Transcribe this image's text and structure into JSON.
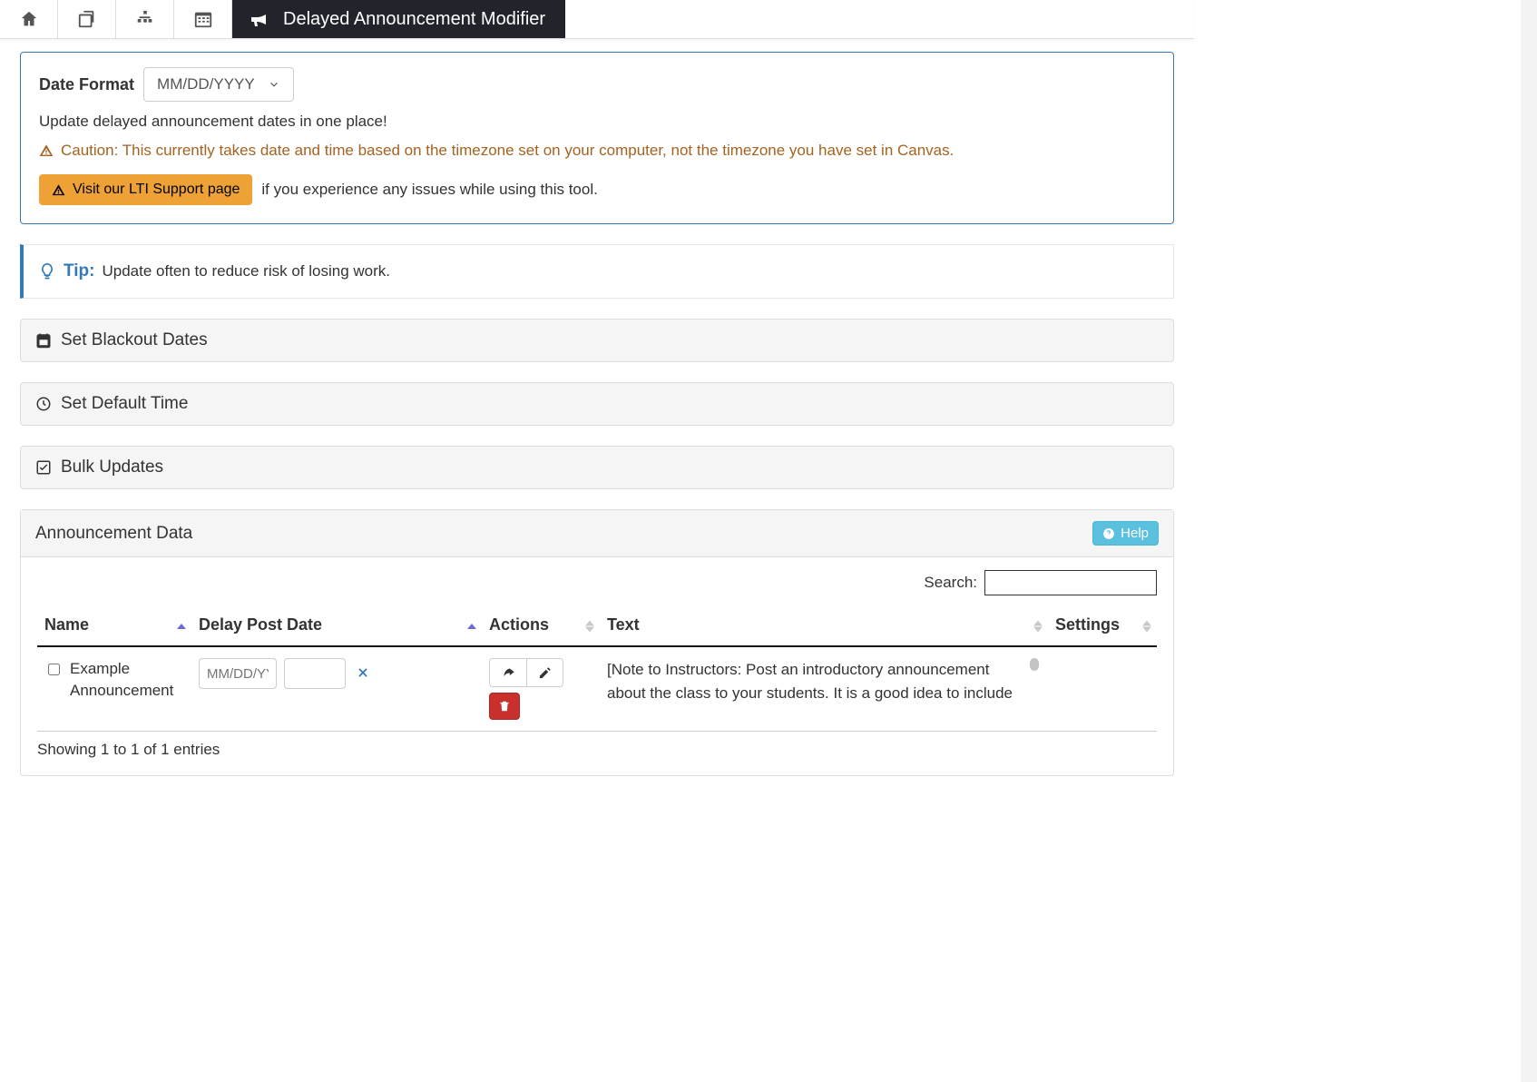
{
  "nav": {
    "active_label": "Delayed Announcement Modifier"
  },
  "panel": {
    "date_format_label": "Date Format",
    "date_format_value": "MM/DD/YYYY",
    "description": "Update delayed announcement dates in one place!",
    "caution": "Caution: This currently takes date and time based on the timezone set on your computer, not the timezone you have set in Canvas.",
    "lti_button": "Visit our LTI Support page",
    "lti_tail": "if you experience any issues while using this tool."
  },
  "tip": {
    "label": "Tip:",
    "text": "Update often to reduce risk of losing work."
  },
  "accordions": {
    "blackout": "Set Blackout Dates",
    "default_time": "Set Default Time",
    "bulk": "Bulk Updates"
  },
  "data_section": {
    "title": "Announcement Data",
    "help_label": "Help",
    "search_label": "Search:",
    "search_value": "",
    "columns": {
      "name": "Name",
      "delay": "Delay Post Date",
      "actions": "Actions",
      "text": "Text",
      "settings": "Settings"
    },
    "row": {
      "name": "Example Announcement",
      "date_placeholder": "MM/DD/YYYY",
      "date_value": "",
      "time_value": "",
      "text": "[Note to Instructors: Post an introductory announcement about the class to your students. It is a good idea to include important information"
    },
    "showing": "Showing 1 to 1 of 1 entries"
  },
  "icons": {
    "home": "home-icon",
    "copy": "copy-icon",
    "sitemap": "sitemap-icon",
    "calendar": "calendar-icon",
    "bullhorn": "bullhorn-icon"
  }
}
